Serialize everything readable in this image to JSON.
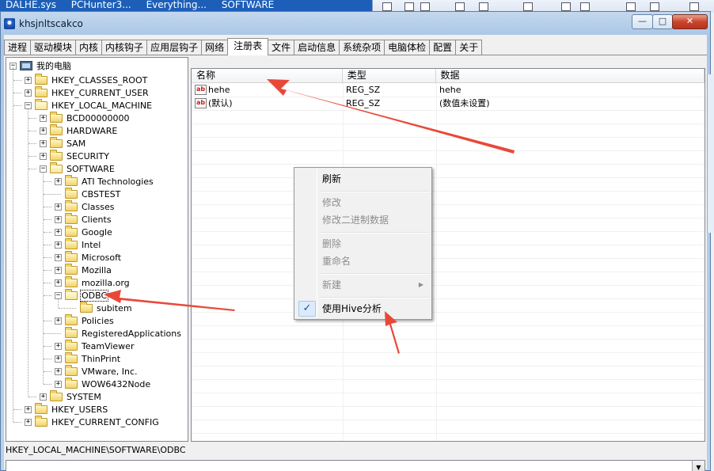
{
  "taskbar": {
    "items": [
      "DALHE.sys",
      "PCHunter3...",
      "Everything...",
      "SOFTWARE"
    ]
  },
  "window": {
    "title": "khsjnltscakco",
    "min_glyph": "—",
    "max_glyph": "□",
    "close_glyph": "✕"
  },
  "tabs": [
    "进程",
    "驱动模块",
    "内核",
    "内核钩子",
    "应用层钩子",
    "网络",
    "注册表",
    "文件",
    "启动信息",
    "系统杂项",
    "电脑体检",
    "配置",
    "关于"
  ],
  "tree": {
    "root": "我的电脑",
    "nodes": [
      {
        "label": "HKEY_CLASSES_ROOT",
        "expander": "+"
      },
      {
        "label": "HKEY_CURRENT_USER",
        "expander": "+"
      },
      {
        "label": "HKEY_LOCAL_MACHINE",
        "expander": "−"
      },
      {
        "label": "BCD00000000",
        "expander": "+"
      },
      {
        "label": "HARDWARE",
        "expander": "+"
      },
      {
        "label": "SAM",
        "expander": "+"
      },
      {
        "label": "SECURITY",
        "expander": "+"
      },
      {
        "label": "SOFTWARE",
        "expander": "−"
      },
      {
        "label": "ATI Technologies",
        "expander": "+"
      },
      {
        "label": "CBSTEST",
        "expander": ""
      },
      {
        "label": "Classes",
        "expander": "+"
      },
      {
        "label": "Clients",
        "expander": "+"
      },
      {
        "label": "Google",
        "expander": "+"
      },
      {
        "label": "Intel",
        "expander": "+"
      },
      {
        "label": "Microsoft",
        "expander": "+"
      },
      {
        "label": "Mozilla",
        "expander": "+"
      },
      {
        "label": "mozilla.org",
        "expander": "+"
      },
      {
        "label": "ODBC",
        "expander": "−"
      },
      {
        "label": "subitem",
        "expander": ""
      },
      {
        "label": "Policies",
        "expander": "+"
      },
      {
        "label": "RegisteredApplications",
        "expander": ""
      },
      {
        "label": "TeamViewer",
        "expander": "+"
      },
      {
        "label": "ThinPrint",
        "expander": "+"
      },
      {
        "label": "VMware, Inc.",
        "expander": "+"
      },
      {
        "label": "WOW6432Node",
        "expander": "+"
      },
      {
        "label": "SYSTEM",
        "expander": "+"
      },
      {
        "label": "HKEY_USERS",
        "expander": "+"
      },
      {
        "label": "HKEY_CURRENT_CONFIG",
        "expander": "+"
      }
    ]
  },
  "list": {
    "columns": [
      "名称",
      "类型",
      "数据"
    ],
    "rows": [
      {
        "icon": "ab",
        "name": "hehe",
        "type": "REG_SZ",
        "data": "hehe"
      },
      {
        "icon": "ab",
        "name": "(默认)",
        "type": "REG_SZ",
        "data": "(数值未设置)"
      }
    ]
  },
  "context_menu": {
    "refresh": "刷新",
    "modify": "修改",
    "modify_binary": "修改二进制数据",
    "delete": "删除",
    "rename": "重命名",
    "new": "新建",
    "use_hive": "使用Hive分析",
    "submenu_arrow": "▶",
    "check": "✓"
  },
  "status": {
    "path": "HKEY_LOCAL_MACHINE\\SOFTWARE\\ODBC"
  },
  "combo": {
    "arrow": "▼"
  },
  "colors": {
    "annotation_arrow": "#e8483a",
    "selection_check": "#1d4f9e"
  }
}
